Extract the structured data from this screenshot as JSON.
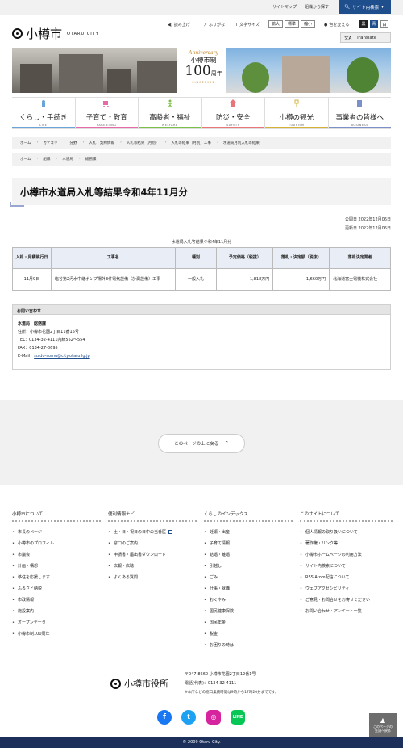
{
  "topbar": {
    "sitemap": "サイトマップ",
    "org_search": "組織から探す",
    "site_search": "サイト内検索"
  },
  "header": {
    "logo_jp": "小樽市",
    "logo_en": "OTARU CITY",
    "read_aloud": "読み上げ",
    "furigana": "ふりがな",
    "font_size_label": "文字サイズ",
    "size_large": "拡大",
    "size_standard": "標準",
    "size_small": "縮小",
    "color_change": "色を変える",
    "color_black": "黒",
    "color_blue": "青",
    "color_white": "白",
    "translate": "Translate"
  },
  "banner": {
    "anniversary": "Anniversary",
    "city_system": "小樽市制",
    "years_num": "100",
    "years_suffix": "周年",
    "since": "SINCE1922"
  },
  "categories": [
    {
      "jp": "くらし・手続き",
      "en": "LIFE",
      "color": "#6aa3d8",
      "icon": "house-person-icon"
    },
    {
      "jp": "子育て・教育",
      "en": "PARENTING",
      "color": "#e66aa8",
      "icon": "stroller-icon"
    },
    {
      "jp": "高齢者・福祉",
      "en": "WELFARE",
      "color": "#7ac04a",
      "icon": "walking-person-icon"
    },
    {
      "jp": "防災・安全",
      "en": "SAFETY",
      "color": "#e8757a",
      "icon": "house-icon"
    },
    {
      "jp": "小樽の観光",
      "en": "TOURISM",
      "color": "#d6b23a",
      "icon": "lamp-icon"
    },
    {
      "jp": "事業者の皆様へ",
      "en": "BUSINESS",
      "color": "#7b8fc8",
      "icon": "building-icon"
    }
  ],
  "breadcrumb1": [
    "ホーム",
    "カテゴリ",
    "分野",
    "入札・契約情報",
    "入札等結果（月別）",
    "入札等結果（月別）工事",
    "水道局月別入札等結果"
  ],
  "breadcrumb2": [
    "ホーム",
    "組織",
    "水道局",
    "総務課"
  ],
  "page_title": "小樽市水道局入札等結果令和4年11月分",
  "dates": {
    "published": "公開日 2022年12月06日",
    "updated": "更新日 2022年12月06日"
  },
  "table": {
    "caption": "水道局入札等結果令和4年11月分",
    "headers": [
      "入札・見積執行日",
      "工事名",
      "種別",
      "予定価格（税抜）",
      "落札・決定額（税抜）",
      "落札決定業者"
    ],
    "rows": [
      [
        "11月9日",
        "塩谷第2汚水中継ポンプ場外3件電気設備（計測設備）工事",
        "一般入札",
        "1,818万円",
        "1,660万円",
        "北海道富士電機株式会社"
      ]
    ]
  },
  "inquiry": {
    "heading": "お問い合わせ",
    "dept": "水道局　総務課",
    "address": "住所：小樽市花園2丁目11番15号",
    "tel": "TEL：0134-32-4111内線552～554",
    "fax": "FAX：0134-27-0695",
    "email_label": "E-Mail：",
    "email": "suido-somu@city.otaru.lg.jp"
  },
  "to_top": "このページの上に戻る",
  "footer_cols": [
    {
      "title": "小樽市について",
      "items": [
        "市長のページ",
        "小樽市のプロフィル",
        "市議会",
        "計画・構想",
        "移住を応援します",
        "ふるさと納税",
        "市政情報",
        "施設案内",
        "オープンデータ",
        "小樽市制100周年"
      ]
    },
    {
      "title": "便利情報ナビ",
      "items": [
        "土・日・祝日の日中の当番医",
        "窓口のご案内",
        "申請書・届出書ダウンロード",
        "広報・広聴",
        "よくある質問"
      ]
    },
    {
      "title": "くらしのインデックス",
      "items": [
        "妊娠・出産",
        "子育て情報",
        "結婚・離婚",
        "引越し",
        "ごみ",
        "仕事・就職",
        "おくやみ",
        "国民健康保険",
        "国民年金",
        "税金",
        "お困りの時は"
      ]
    },
    {
      "title": "このサイトについて",
      "items": [
        "個人情報の取り扱いについて",
        "著作権・リンク等",
        "小樽市ホームページの利用方法",
        "サイト内検索について",
        "RSS,Atom配信について",
        "ウェブアクセシビリティ",
        "ご意見・お問合せをお寄せください",
        "お問い合わせ・アンケート一覧"
      ]
    }
  ],
  "footer": {
    "office": "小樽市役所",
    "address": "〒047-8660 小樽市花園2丁目12番1号",
    "phone": "電話(代表)：0134-32-4111",
    "hours": "※本庁などの窓口業務時間は9時から17時20分までです。",
    "pagetop_line1": "このページの",
    "pagetop_line2": "先頭へ戻る",
    "copyright": "© 2009 Otaru City."
  },
  "colors": {
    "navy": "#1b2f5a",
    "search_blue": "#1f4e8c",
    "facebook": "#1877f2",
    "twitter": "#1da1f2",
    "instagram": "#d6249f",
    "line": "#06c755"
  }
}
